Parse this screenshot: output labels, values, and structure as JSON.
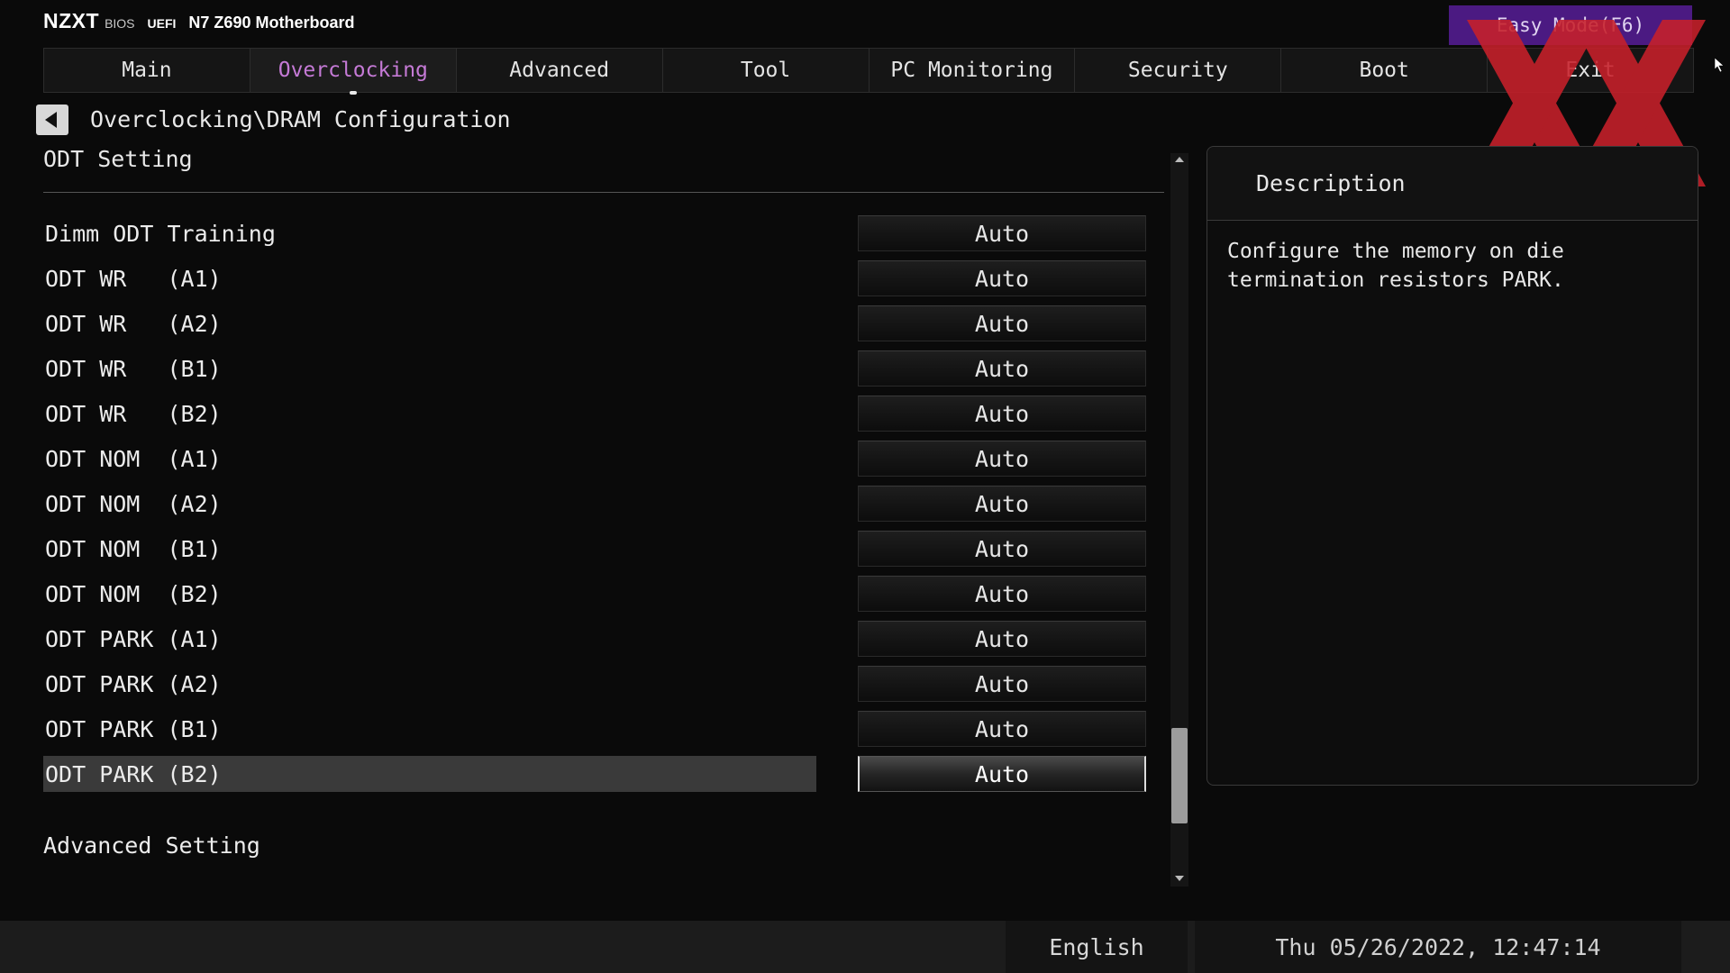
{
  "header": {
    "logo": "NZXT",
    "bios_label": "BIOS",
    "uefi_label": "UEFI",
    "model": "N7 Z690 Motherboard",
    "easy_mode": "Easy Mode(F6)"
  },
  "tabs": [
    {
      "label": "Main"
    },
    {
      "label": "Overclocking",
      "active": true
    },
    {
      "label": "Advanced"
    },
    {
      "label": "Tool"
    },
    {
      "label": "PC Monitoring"
    },
    {
      "label": "Security"
    },
    {
      "label": "Boot"
    },
    {
      "label": "Exit"
    }
  ],
  "breadcrumb": "Overclocking\\DRAM Configuration",
  "section_title": "ODT Setting",
  "settings": [
    {
      "label": "Dimm ODT Training",
      "value": "Auto"
    },
    {
      "label": "ODT WR   (A1)",
      "value": "Auto"
    },
    {
      "label": "ODT WR   (A2)",
      "value": "Auto"
    },
    {
      "label": "ODT WR   (B1)",
      "value": "Auto"
    },
    {
      "label": "ODT WR   (B2)",
      "value": "Auto"
    },
    {
      "label": "ODT NOM  (A1)",
      "value": "Auto"
    },
    {
      "label": "ODT NOM  (A2)",
      "value": "Auto"
    },
    {
      "label": "ODT NOM  (B1)",
      "value": "Auto"
    },
    {
      "label": "ODT NOM  (B2)",
      "value": "Auto"
    },
    {
      "label": "ODT PARK (A1)",
      "value": "Auto"
    },
    {
      "label": "ODT PARK (A2)",
      "value": "Auto"
    },
    {
      "label": "ODT PARK (B1)",
      "value": "Auto"
    },
    {
      "label": "ODT PARK (B2)",
      "value": "Auto",
      "selected": true
    }
  ],
  "advanced_setting": "Advanced Setting",
  "description": {
    "title": "Description",
    "text": "Configure the memory on die\ntermination resistors PARK."
  },
  "footer": {
    "language": "English",
    "datetime": "Thu 05/26/2022, 12:47:14"
  },
  "colors": {
    "active_tab": "#c57ad6",
    "easy_mode_bg": "#4b1a82",
    "watermark": "#c8202a"
  },
  "icons": {
    "back": "back-arrow-icon",
    "scroll_up": "scroll-up-arrow-icon",
    "scroll_down": "scroll-down-arrow-icon",
    "cursor": "mouse-cursor-icon",
    "watermark": "watermark-logo-icon"
  }
}
